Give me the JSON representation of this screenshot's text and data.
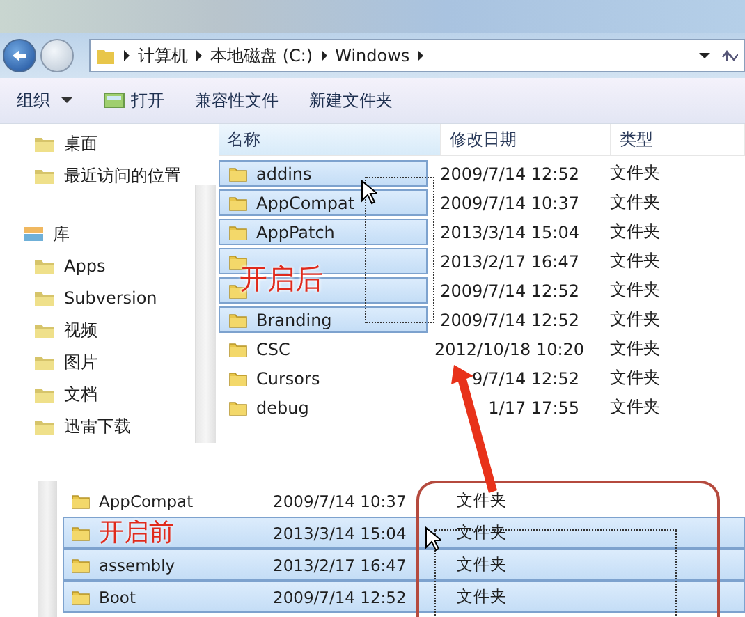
{
  "breadcrumb": [
    "计算机",
    "本地磁盘 (C:)",
    "Windows"
  ],
  "toolbar": [
    {
      "label": "组织",
      "kind": "menu"
    },
    {
      "label": "打开",
      "kind": "icon"
    },
    {
      "label": "兼容性文件",
      "kind": "plain"
    },
    {
      "label": "新建文件夹",
      "kind": "plain"
    }
  ],
  "sidebar": {
    "items": [
      {
        "label": "桌面",
        "kind": "item"
      },
      {
        "label": "最近访问的位置",
        "kind": "item"
      },
      {
        "label": "库",
        "kind": "group"
      },
      {
        "label": "Apps",
        "kind": "item"
      },
      {
        "label": "Subversion",
        "kind": "item"
      },
      {
        "label": "视频",
        "kind": "item"
      },
      {
        "label": "图片",
        "kind": "item"
      },
      {
        "label": "文档",
        "kind": "item"
      },
      {
        "label": "迅雷下载",
        "kind": "item"
      }
    ]
  },
  "columns": [
    "名称",
    "修改日期",
    "类型"
  ],
  "after": {
    "label": "开启后",
    "full_row_select": false,
    "rows": [
      {
        "name": "addins",
        "date": "2009/7/14 12:52",
        "type": "文件夹",
        "selected": true
      },
      {
        "name": "AppCompat",
        "date": "2009/7/14 10:37",
        "type": "文件夹",
        "selected": true
      },
      {
        "name": "AppPatch",
        "date": "2013/3/14 15:04",
        "type": "文件夹",
        "selected": true
      },
      {
        "date": "2013/2/17 16:47",
        "type": "文件夹",
        "selected": true
      },
      {
        "date": "2009/7/14 12:52",
        "type": "文件夹",
        "selected": true
      },
      {
        "name": "Branding",
        "date": "2009/7/14 12:52",
        "type": "文件夹",
        "selected": true
      },
      {
        "name": "CSC",
        "date": "2012/10/18 10:20",
        "type": "文件夹",
        "selected": false
      },
      {
        "name": "Cursors",
        "date": "9/7/14 12:52",
        "type": "文件夹",
        "selected": false
      },
      {
        "name": "debug",
        "date": "1/17 17:55",
        "type": "文件夹",
        "selected": false
      }
    ]
  },
  "before": {
    "label": "开启前",
    "full_row_select": true,
    "rows": [
      {
        "name": "AppCompat",
        "date": "2009/7/14 10:37",
        "type": "文件夹",
        "selected": false
      },
      {
        "date": "2013/3/14 15:04",
        "type": "文件夹",
        "selected": true
      },
      {
        "name": "assembly",
        "date": "2013/2/17 16:47",
        "type": "文件夹",
        "selected": true
      },
      {
        "name": "Boot",
        "date": "2009/7/14 12:52",
        "type": "文件夹",
        "selected": true
      }
    ]
  }
}
